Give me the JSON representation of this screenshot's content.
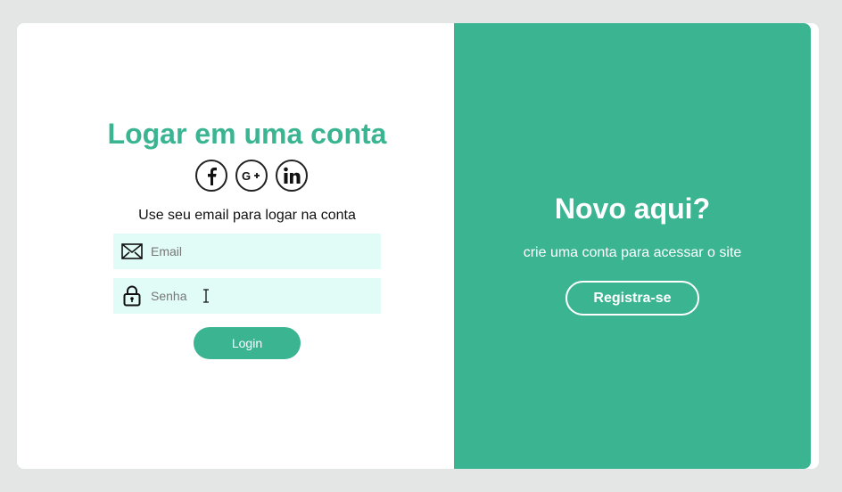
{
  "login": {
    "title": "Logar em uma conta",
    "social": [
      "facebook-icon",
      "google-plus-icon",
      "linkedin-icon"
    ],
    "subtitle": "Use seu email para logar na conta",
    "email_placeholder": "Email",
    "password_placeholder": "Senha",
    "button_label": "Login"
  },
  "register": {
    "title": "Novo aqui?",
    "text": "crie uma conta para acessar o site",
    "button_label": "Registra-se"
  },
  "colors": {
    "accent": "#3bb492",
    "input_bg": "#e1fbf7",
    "page_bg": "#e4e6e5"
  }
}
